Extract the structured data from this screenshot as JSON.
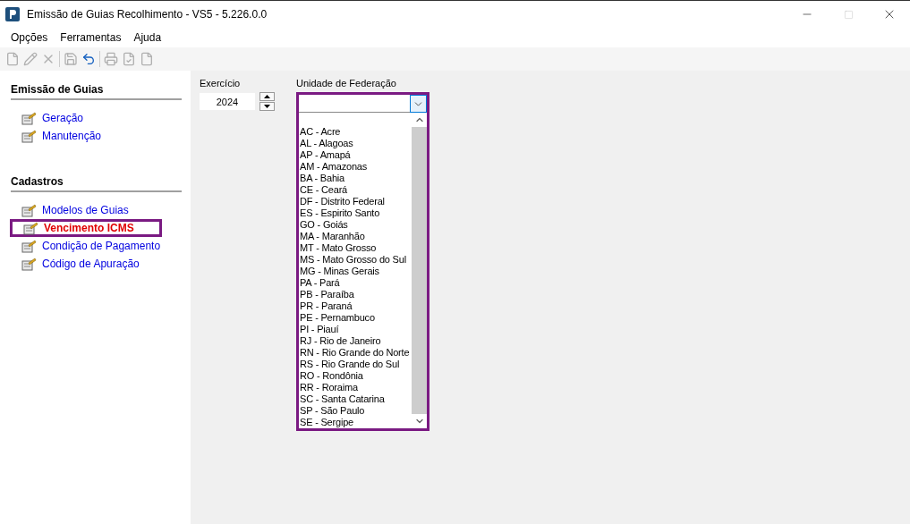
{
  "window": {
    "title": "Emissão de Guias Recolhimento - VS5 - 5.226.0.0"
  },
  "menu": [
    "Opções",
    "Ferramentas",
    "Ajuda"
  ],
  "toolbar": [
    {
      "kind": "new",
      "disabled": true
    },
    {
      "kind": "edit",
      "disabled": true
    },
    {
      "kind": "delete",
      "disabled": true
    },
    {
      "kind": "sep"
    },
    {
      "kind": "save",
      "disabled": true
    },
    {
      "kind": "undo",
      "disabled": false
    },
    {
      "kind": "sep"
    },
    {
      "kind": "print",
      "disabled": true
    },
    {
      "kind": "check",
      "disabled": true
    },
    {
      "kind": "doc",
      "disabled": true
    }
  ],
  "sidebar": {
    "sections": [
      {
        "title": "Emissão de Guias",
        "items": [
          {
            "label": "Geração",
            "selected": false
          },
          {
            "label": "Manutenção",
            "selected": false
          }
        ]
      },
      {
        "title": "Cadastros",
        "items": [
          {
            "label": "Modelos de Guias",
            "selected": false
          },
          {
            "label": "Vencimento ICMS",
            "selected": true
          },
          {
            "label": "Condição de Pagamento",
            "selected": false
          },
          {
            "label": "Código de Apuração",
            "selected": false
          }
        ]
      }
    ]
  },
  "exercicio": {
    "label": "Exercício",
    "value": "2024"
  },
  "uf": {
    "label": "Unidade de Federação",
    "expanded": true,
    "highlighted": true,
    "options": [
      "AC - Acre",
      "AL - Alagoas",
      "AP - Amapá",
      "AM - Amazonas",
      "BA - Bahia",
      "CE - Ceará",
      "DF - Distrito Federal",
      "ES - Espirito Santo",
      "GO - Goiás",
      "MA - Maranhão",
      "MT - Mato Grosso",
      "MS - Mato Grosso do Sul",
      "MG - Minas Gerais",
      "PA - Pará",
      "PB - Paraíba",
      "PR - Paraná",
      "PE - Pernambuco",
      "PI - Piauí",
      "RJ - Rio de Janeiro",
      "RN - Rio Grande do Norte",
      "RS - Rio Grande do Sul",
      "RO - Rondônia",
      "RR - Roraima",
      "SC - Santa Catarina",
      "SP - São Paulo",
      "SE - Sergipe"
    ]
  }
}
